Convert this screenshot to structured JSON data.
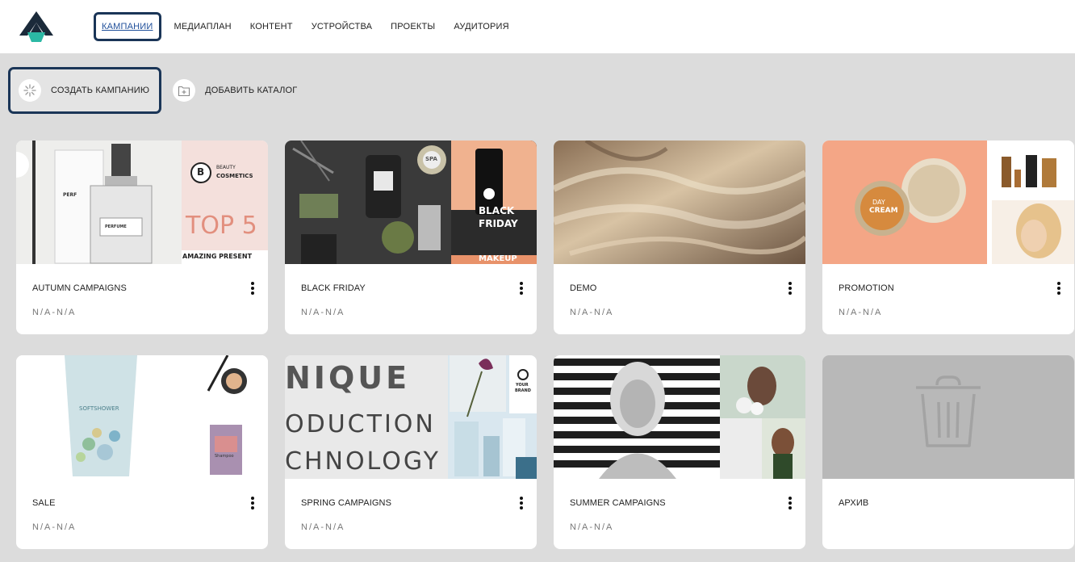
{
  "nav": {
    "items": [
      "КАМПАНИИ",
      "МЕДИАПЛАН",
      "КОНТЕНТ",
      "УСТРОЙСТВА",
      "ПРОЕКТЫ",
      "АУДИТОРИЯ"
    ]
  },
  "toolbar": {
    "create_label": "СОЗДАТЬ КАМПАНИЮ",
    "catalog_label": "ДОБАВИТЬ КАТАЛОГ"
  },
  "campaigns": [
    {
      "title": "AUTUMN CAMPAIGNS",
      "dates": "N/A-N/A",
      "thumb_text": {
        "brand_initial": "B",
        "brand_line1": "BEAUTY",
        "brand_line2": "COSMETICS",
        "headline": "TOP 5",
        "subline": "AMAZING PRESENT",
        "tag1": "PERF",
        "tag2": "PERFUME"
      }
    },
    {
      "title": "BLACK FRIDAY",
      "dates": "N/A-N/A",
      "thumb_text": {
        "line1": "BLACK",
        "line2": "FRIDAY",
        "line3": "MAKEUP",
        "tag": "SPA"
      }
    },
    {
      "title": "DEMO",
      "dates": "N/A-N/A"
    },
    {
      "title": "PROMOTION",
      "dates": "N/A-N/A",
      "thumb_text": {
        "line1": "DAY",
        "line2": "CREAM"
      }
    },
    {
      "title": "SALE",
      "dates": "N/A-N/A",
      "thumb_text": {
        "product": "SOFTSHOWER",
        "tag": "Shampoo"
      }
    },
    {
      "title": "SPRING CAMPAIGNS",
      "dates": "N/A-N/A",
      "thumb_text": {
        "line1": "NIQUE",
        "line2": "ODUCTION",
        "line3": "CHNOLOGY",
        "brand_line1": "YOUR",
        "brand_line2": "BRAND"
      }
    },
    {
      "title": "SUMMER CAMPAIGNS",
      "dates": "N/A-N/A"
    },
    {
      "title": "АРХИВ"
    }
  ],
  "icons": {
    "logo": "logo-icon",
    "create": "sparkle-icon",
    "catalog": "folder-plus-icon",
    "menu": "kebab-menu-icon",
    "archive": "trash-icon"
  },
  "colors": {
    "accent_outline": "#1a3557",
    "active_link": "#1f4f9a",
    "logo_dark": "#1b2a3a",
    "logo_teal": "#2bb8a4",
    "background": "#dcdcdc"
  }
}
